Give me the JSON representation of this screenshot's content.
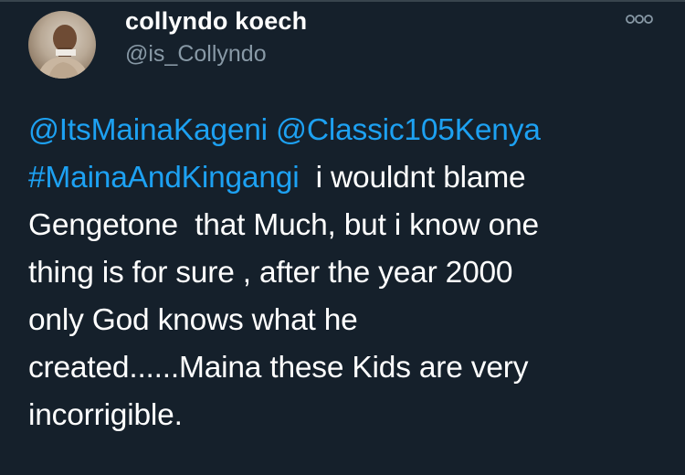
{
  "tweet": {
    "author": {
      "display_name": "collyndo koech",
      "handle": "@is_Collyndo"
    },
    "more_icon": "more-horizontal-icon",
    "text": {
      "line1": {
        "mention1": "@ItsMainaKageni",
        "sep": " ",
        "mention2": "@Classic105Kenya"
      },
      "line2": {
        "hashtag": "#MainaAndKingangi",
        "rest": "  i wouldnt blame"
      },
      "line3": "Gengetone  that Much, but i know one",
      "line4": "thing is for sure , after the year 2000",
      "line5": "only God knows what he",
      "line6": "created......Maina these Kids are very",
      "line7": "incorrigible."
    }
  },
  "colors": {
    "background": "#15202b",
    "link": "#1da1f2",
    "secondary_text": "#8899a6",
    "primary_text": "#ffffff"
  }
}
